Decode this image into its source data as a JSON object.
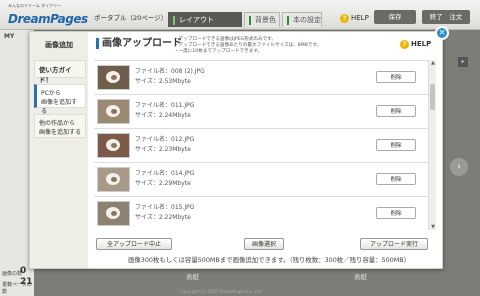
{
  "app": {
    "logo_small": "みんなのドリーム ダイアリー",
    "logo": "DreamPages",
    "mode": "ポータブル（20ページ）",
    "tabs": [
      {
        "label": "レイアウト",
        "active": true
      },
      {
        "label": "背景色",
        "active": false
      },
      {
        "label": "本の設定",
        "active": false
      }
    ],
    "help": "HELP",
    "save": "保存",
    "finish_order": "終了　注文",
    "sidebar_title": "MY",
    "stats": [
      {
        "label": "画像の数",
        "value": "0"
      },
      {
        "label": "書籍ペースの数",
        "value": "21"
      }
    ],
    "bottom_labels": [
      "表紙",
      "表紙"
    ],
    "copyright": "Copyright (C) 2007 DreamPages Inc. Ltd."
  },
  "modal": {
    "side_title": "画像追加",
    "side_items": [
      {
        "label": "使い方ガイド！",
        "active": false
      },
      {
        "label": "PCから\n画像を追加する",
        "active": true
      },
      {
        "label": "他の作品から\n画像を追加する",
        "active": false
      }
    ],
    "title": "画像アップロード",
    "notes": [
      "・アップロードできる画像はJPEG形式のみです。",
      "・アップロードできる画像あたりの最大ファイルサイズは、8MBです。",
      "・一度に10枚までアップロードできます。"
    ],
    "help": "HELP",
    "name_prefix": "ファイル名：",
    "size_prefix": "サイズ：",
    "files": [
      {
        "name": "008 (2).JPG",
        "size": "2.53Mbyte"
      },
      {
        "name": "011.JPG",
        "size": "2.24Mbyte"
      },
      {
        "name": "012.JPG",
        "size": "2.23Mbyte"
      },
      {
        "name": "014.JPG",
        "size": "2.29Mbyte"
      },
      {
        "name": "015.JPG",
        "size": "2.22Mbyte"
      }
    ],
    "delete_label": "削除",
    "cancel_all": "全アップロード中止",
    "select_image": "画像選択",
    "upload_run": "アップロード実行",
    "footer": "画像300枚もしくは容量500MBまで画像追加できます。（残り枚数：300枚／残り容量：500MB）"
  }
}
